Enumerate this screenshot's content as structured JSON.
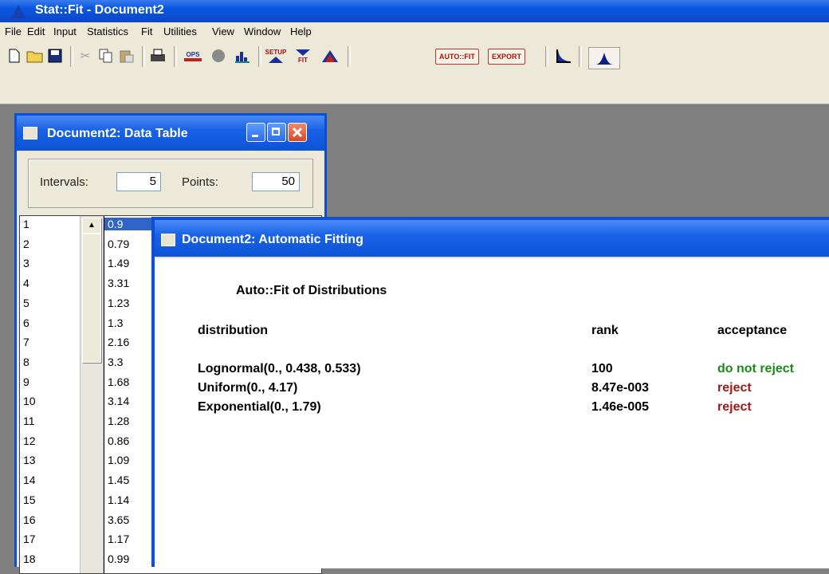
{
  "app": {
    "title": "Stat::Fit - Document2"
  },
  "menu": [
    "File",
    "Edit",
    "Input",
    "Statistics",
    "Fit",
    "Utilities",
    "View",
    "Window",
    "Help"
  ],
  "toolbar": {
    "auto_fit_label": "AUTO::FIT",
    "export_label": "EXPORT",
    "ops_label": "OPS",
    "setup_label": "SETUP",
    "fit_label": "FIT"
  },
  "data_table": {
    "title": "Document2: Data Table",
    "intervals_label": "Intervals:",
    "intervals_value": "5",
    "points_label": "Points:",
    "points_value": "50",
    "rows": [
      {
        "index": "1",
        "value": "0.9"
      },
      {
        "index": "2",
        "value": "0.79"
      },
      {
        "index": "3",
        "value": "1.49"
      },
      {
        "index": "4",
        "value": "3.31"
      },
      {
        "index": "5",
        "value": "1.23"
      },
      {
        "index": "6",
        "value": "1.3"
      },
      {
        "index": "7",
        "value": "2.16"
      },
      {
        "index": "8",
        "value": "3.3"
      },
      {
        "index": "9",
        "value": "1.68"
      },
      {
        "index": "10",
        "value": "3.14"
      },
      {
        "index": "11",
        "value": "1.28"
      },
      {
        "index": "12",
        "value": "0.86"
      },
      {
        "index": "13",
        "value": "1.09"
      },
      {
        "index": "14",
        "value": "1.45"
      },
      {
        "index": "15",
        "value": "1.14"
      },
      {
        "index": "16",
        "value": "3.65"
      },
      {
        "index": "17",
        "value": "1.17"
      },
      {
        "index": "18",
        "value": "0.99"
      }
    ]
  },
  "auto_fit": {
    "title": "Document2: Automatic Fitting",
    "heading": "Auto::Fit of Distributions",
    "col_distribution": "distribution",
    "col_rank": "rank",
    "col_acceptance": "acceptance",
    "results": [
      {
        "distribution": "Lognormal(0., 0.438, 0.533)",
        "rank": "100",
        "acceptance": "do not reject"
      },
      {
        "distribution": "Uniform(0., 4.17)",
        "rank": "8.47e-003",
        "acceptance": "reject"
      },
      {
        "distribution": "Exponential(0., 1.79)",
        "rank": "1.46e-005",
        "acceptance": "reject"
      }
    ]
  },
  "colors": {
    "accept": "#1a8a1a",
    "reject": "#a01818",
    "titlebar": "#0a4fd4"
  }
}
